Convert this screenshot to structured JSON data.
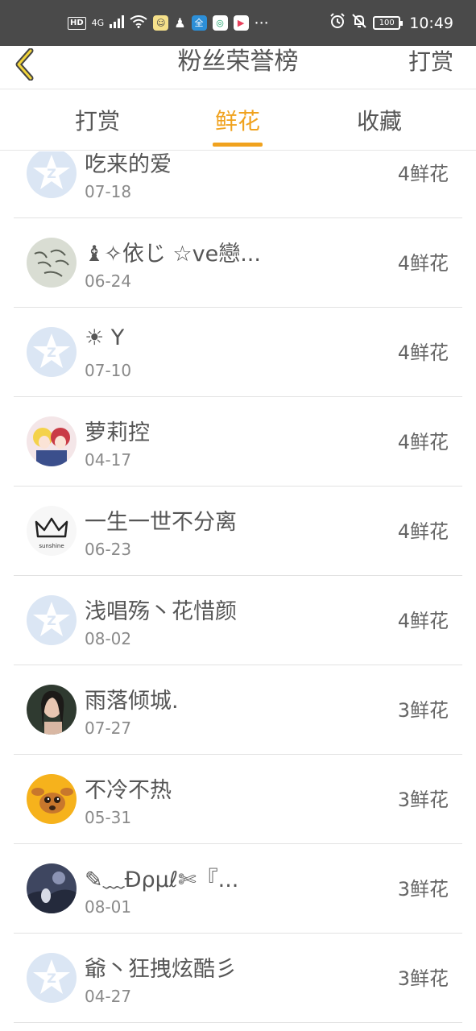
{
  "status_bar": {
    "hd": "HD",
    "network": "4G",
    "time": "10:49",
    "battery": "100",
    "more": "···"
  },
  "header": {
    "title": "粉丝荣誉榜",
    "action": "打赏"
  },
  "tabs": [
    {
      "label": "打赏",
      "active": false
    },
    {
      "label": "鲜花",
      "active": true
    },
    {
      "label": "收藏",
      "active": false
    }
  ],
  "colors": {
    "accent": "#f0a21e",
    "status_bar": "#4a4a4a",
    "default_avatar": "#dbe6f4"
  },
  "fans": [
    {
      "name": "吃来的爱",
      "date": "07-18",
      "count": "4鲜花",
      "avatar": "default"
    },
    {
      "name": "♝✧依じ ☆ve戀...",
      "date": "06-24",
      "count": "4鲜花",
      "avatar": "handwriting"
    },
    {
      "name": "☀ Y",
      "date": "07-10",
      "count": "4鲜花",
      "avatar": "default"
    },
    {
      "name": "萝莉控",
      "date": "04-17",
      "count": "4鲜花",
      "avatar": "anime"
    },
    {
      "name": "一生一世不分离",
      "date": "06-23",
      "count": "4鲜花",
      "avatar": "crown"
    },
    {
      "name": "浅唱殇丶花惜颜",
      "date": "08-02",
      "count": "4鲜花",
      "avatar": "default"
    },
    {
      "name": "雨落倾城.",
      "date": "07-27",
      "count": "3鲜花",
      "avatar": "portrait"
    },
    {
      "name": "不冷不热",
      "date": "05-31",
      "count": "3鲜花",
      "avatar": "deer"
    },
    {
      "name": "✎﹏Đρμℓ✄『...",
      "date": "08-01",
      "count": "3鲜花",
      "avatar": "landscape"
    },
    {
      "name": "爺丶狂拽炫酷彡",
      "date": "04-27",
      "count": "3鲜花",
      "avatar": "default"
    }
  ]
}
